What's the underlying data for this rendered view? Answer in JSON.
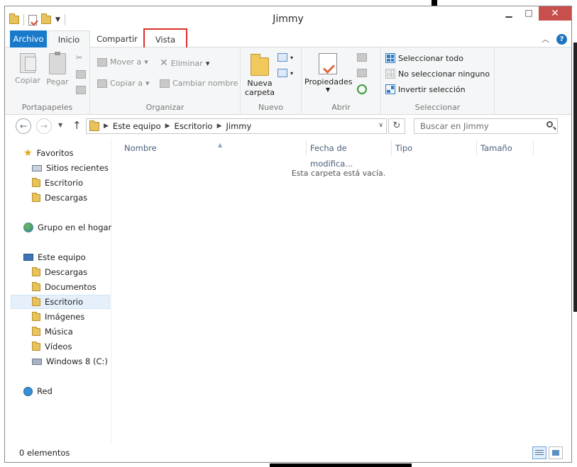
{
  "window": {
    "title": "Jimmy"
  },
  "ribbon_tabs": [
    "Archivo",
    "Inicio",
    "Compartir",
    "Vista"
  ],
  "groups": {
    "portapapeles": {
      "label": "Portapapeles",
      "copy": "Copiar",
      "paste": "Pegar"
    },
    "organizar": {
      "label": "Organizar",
      "move_to": "Mover a",
      "copy_to": "Copiar a",
      "delete": "Eliminar",
      "rename": "Cambiar nombre"
    },
    "nuevo": {
      "label": "Nuevo",
      "new_folder": "Nueva carpeta"
    },
    "abrir": {
      "label": "Abrir",
      "properties": "Propiedades"
    },
    "seleccionar": {
      "label": "Seleccionar",
      "select_all": "Seleccionar todo",
      "select_none": "No seleccionar ninguno",
      "invert": "Invertir selección"
    }
  },
  "address": {
    "crumbs": [
      "Este equipo",
      "Escritorio",
      "Jimmy"
    ]
  },
  "search": {
    "placeholder": "Buscar en Jimmy"
  },
  "nav": {
    "favorites": {
      "label": "Favoritos",
      "items": [
        "Sitios recientes",
        "Escritorio",
        "Descargas"
      ]
    },
    "homegroup": "Grupo en el hogar",
    "this_pc": {
      "label": "Este equipo",
      "items": [
        "Descargas",
        "Documentos",
        "Escritorio",
        "Imágenes",
        "Música",
        "Vídeos",
        "Windows 8 (C:)"
      ]
    },
    "network": "Red"
  },
  "columns": [
    "Nombre",
    "Fecha de modifica...",
    "Tipo",
    "Tamaño"
  ],
  "empty_message": "Esta carpeta está vacía.",
  "status": {
    "count": "0 elementos"
  },
  "colors": {
    "accent": "#1979ca",
    "highlight_box": "#d9302c",
    "close_button": "#c7504c"
  }
}
